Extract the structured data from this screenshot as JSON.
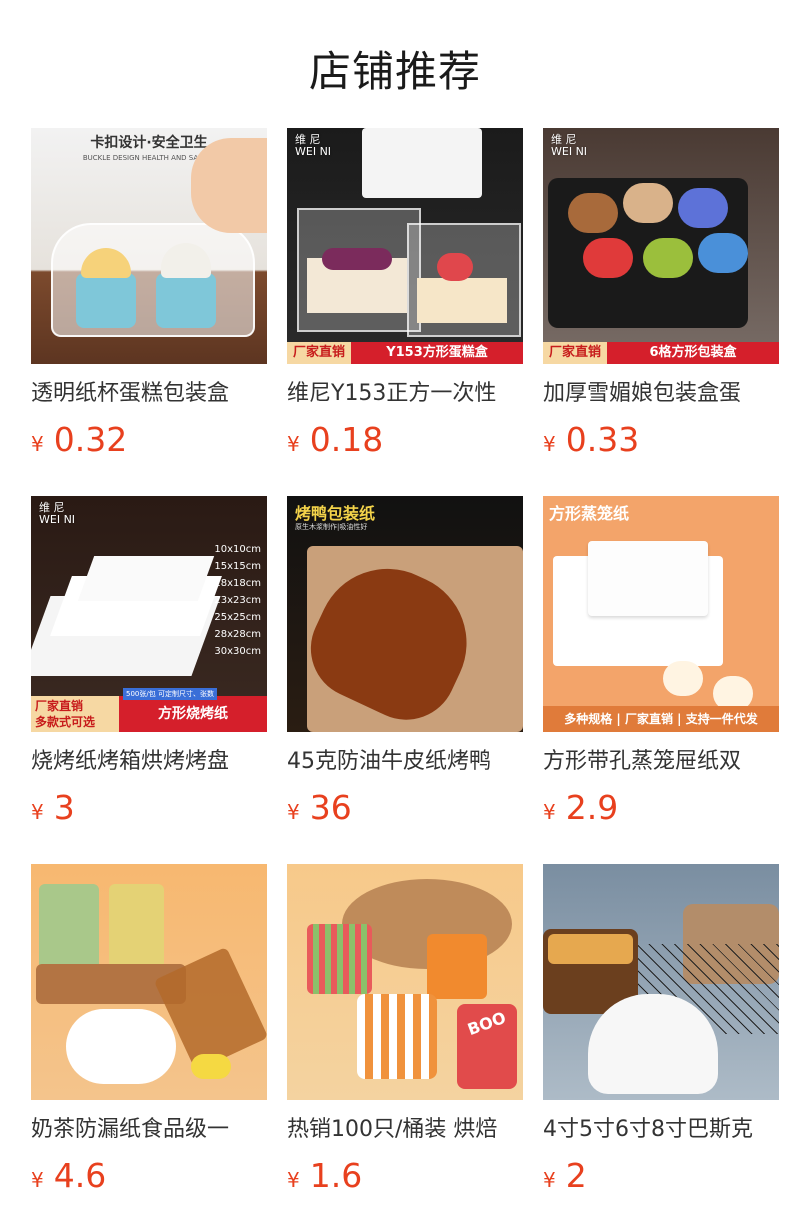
{
  "page": {
    "title": "店铺推荐"
  },
  "currency_symbol": "¥",
  "colors": {
    "price": "#e8401e",
    "title": "#1a1a1a",
    "banner_red": "#d51f2b"
  },
  "products": [
    {
      "title": "透明纸杯蛋糕包装盒",
      "price": "0.32",
      "image": {
        "headline": "卡扣设计·安全卫生",
        "subline": "BUCKLE DESIGN HEALTH AND SAFETY"
      }
    },
    {
      "title": "维尼Y153正方一次性",
      "price": "0.18",
      "image": {
        "brand": "维 尼\nWEI NI",
        "banner_left": "厂家直销",
        "banner_right": "Y153方形蛋糕盒"
      }
    },
    {
      "title": "加厚雪媚娘包装盒蛋",
      "price": "0.33",
      "image": {
        "brand": "维 尼\nWEI NI",
        "banner_left": "厂家直销",
        "banner_right": "6格方形包装盒"
      }
    },
    {
      "title": "烧烤纸烤箱烘烤烤盘",
      "price": "3",
      "image": {
        "brand": "维 尼\nWEI NI",
        "sizes": [
          "10x10cm",
          "15x15cm",
          "18x18cm",
          "23x23cm",
          "25x25cm",
          "28x28cm",
          "30x30cm"
        ],
        "banner_left": "厂家直销\n多款式可选",
        "banner_note": "500张/包 可定制尺寸、张数",
        "banner_right": "方形烧烤纸"
      }
    },
    {
      "title": "45克防油牛皮纸烤鸭",
      "price": "36",
      "image": {
        "headline": "烤鸭包装纸",
        "subline": "原生木浆制作|吸油性好"
      }
    },
    {
      "title": "方形带孔蒸笼屉纸双",
      "price": "2.9",
      "image": {
        "headline": "方形蒸笼纸",
        "subline": "多种规格 | 厂家直销 | 支持一件代发"
      }
    },
    {
      "title": "奶茶防漏纸食品级一",
      "price": "4.6",
      "image": {}
    },
    {
      "title": "热销100只/桶装 烘焙",
      "price": "1.6",
      "image": {
        "label": "BOO"
      }
    },
    {
      "title": "4寸5寸6寸8寸巴斯克",
      "price": "2",
      "image": {}
    }
  ]
}
